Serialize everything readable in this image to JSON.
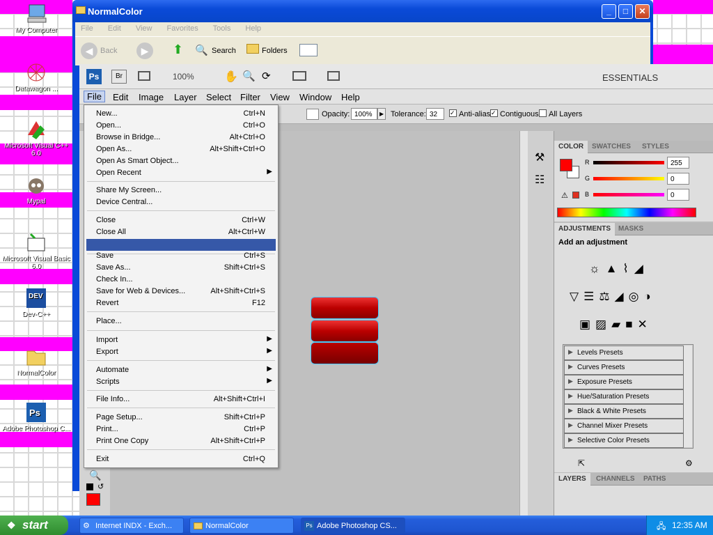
{
  "desktop": {
    "icons": [
      {
        "label": "My Computer",
        "icon": "computer-icon"
      },
      {
        "label": "Datawagon ...",
        "icon": "datawagon-icon"
      },
      {
        "label": "Microsoft Visual C++ 6.0",
        "icon": "vcpp-icon"
      },
      {
        "label": "Mypal",
        "icon": "mypal-icon"
      },
      {
        "label": "Microsoft Visual Basic 6.0",
        "icon": "vb-icon"
      },
      {
        "label": "Dev-C++",
        "icon": "devcpp-icon"
      },
      {
        "label": "NormalColor",
        "icon": "folder-icon"
      },
      {
        "label": "Adobe Photoshop C...",
        "icon": "photoshop-icon"
      }
    ]
  },
  "explorer": {
    "title": "NormalColor",
    "menu": [
      "File",
      "Edit",
      "View",
      "Favorites",
      "Tools",
      "Help"
    ],
    "toolbar": {
      "back": "Back",
      "search": "Search",
      "folders": "Folders"
    }
  },
  "photoshop": {
    "topbar": {
      "ps": "Ps",
      "br": "Br",
      "zoom": "100%",
      "workspace": "ESSENTIALS"
    },
    "menu": [
      "File",
      "Edit",
      "Image",
      "Layer",
      "Select",
      "Filter",
      "View",
      "Window",
      "Help"
    ],
    "options": {
      "opacity_label": "Opacity:",
      "opacity": "100%",
      "tolerance_label": "Tolerance:",
      "tolerance": "32",
      "anti_alias": "Anti-alias",
      "contiguous": "Contiguous",
      "all_layers": "All Layers"
    },
    "color_panel": {
      "tabs": [
        "COLOR",
        "SWATCHES",
        "STYLES"
      ],
      "r_label": "R",
      "r": "255",
      "g_label": "G",
      "g": "0",
      "b_label": "B",
      "b": "0",
      "foreground": "#ff0000"
    },
    "adjustments_panel": {
      "tabs": [
        "ADJUSTMENTS",
        "MASKS"
      ],
      "heading": "Add an adjustment",
      "presets": [
        "Levels Presets",
        "Curves Presets",
        "Exposure Presets",
        "Hue/Saturation Presets",
        "Black & White Presets",
        "Channel Mixer Presets",
        "Selective Color Presets"
      ]
    },
    "layers_panel": {
      "tabs": [
        "LAYERS",
        "CHANNELS",
        "PATHS"
      ]
    },
    "file_menu": {
      "groups": [
        [
          {
            "label": "New...",
            "shortcut": "Ctrl+N"
          },
          {
            "label": "Open...",
            "shortcut": "Ctrl+O"
          },
          {
            "label": "Browse in Bridge...",
            "shortcut": "Alt+Ctrl+O"
          },
          {
            "label": "Open As...",
            "shortcut": "Alt+Shift+Ctrl+O"
          },
          {
            "label": "Open As Smart Object...",
            "shortcut": ""
          },
          {
            "label": "Open Recent",
            "shortcut": "",
            "submenu": true
          }
        ],
        [
          {
            "label": "Share My Screen...",
            "shortcut": ""
          },
          {
            "label": "Device Central...",
            "shortcut": ""
          }
        ],
        [
          {
            "label": "Close",
            "shortcut": "Ctrl+W"
          },
          {
            "label": "Close All",
            "shortcut": "Alt+Ctrl+W"
          },
          {
            "label": "",
            "shortcut": "",
            "highlight": true
          }
        ],
        [
          {
            "label": "Save",
            "shortcut": "Ctrl+S"
          },
          {
            "label": "Save As...",
            "shortcut": "Shift+Ctrl+S"
          },
          {
            "label": "Check In...",
            "shortcut": ""
          },
          {
            "label": "Save for Web & Devices...",
            "shortcut": "Alt+Shift+Ctrl+S"
          },
          {
            "label": "Revert",
            "shortcut": "F12"
          }
        ],
        [
          {
            "label": "Place...",
            "shortcut": ""
          }
        ],
        [
          {
            "label": "Import",
            "shortcut": "",
            "submenu": true
          },
          {
            "label": "Export",
            "shortcut": "",
            "submenu": true
          }
        ],
        [
          {
            "label": "Automate",
            "shortcut": "",
            "submenu": true
          },
          {
            "label": "Scripts",
            "shortcut": "",
            "submenu": true
          }
        ],
        [
          {
            "label": "File Info...",
            "shortcut": "Alt+Shift+Ctrl+I"
          }
        ],
        [
          {
            "label": "Page Setup...",
            "shortcut": "Shift+Ctrl+P"
          },
          {
            "label": "Print...",
            "shortcut": "Ctrl+P"
          },
          {
            "label": "Print One Copy",
            "shortcut": "Alt+Shift+Ctrl+P"
          }
        ],
        [
          {
            "label": "Exit",
            "shortcut": "Ctrl+Q"
          }
        ]
      ]
    }
  },
  "taskbar": {
    "start": "start",
    "buttons": [
      {
        "label": "Internet INDX - Exch...",
        "active": false
      },
      {
        "label": "NormalColor",
        "active": false
      },
      {
        "label": "Adobe Photoshop CS...",
        "active": true
      }
    ],
    "clock": "12:35 AM"
  }
}
